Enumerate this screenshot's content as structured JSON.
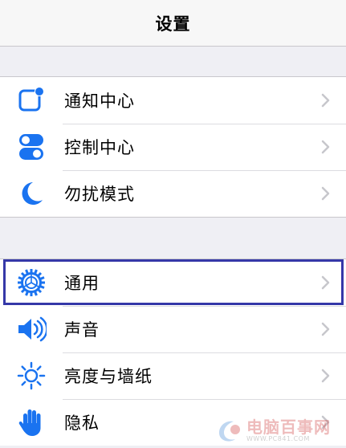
{
  "nav": {
    "title": "设置"
  },
  "groups": [
    {
      "items": [
        {
          "label": "通知中心",
          "icon": "notification-center-icon"
        },
        {
          "label": "控制中心",
          "icon": "control-center-icon"
        },
        {
          "label": "勿扰模式",
          "icon": "moon-icon"
        }
      ]
    },
    {
      "items": [
        {
          "label": "通用",
          "icon": "gear-icon"
        },
        {
          "label": "声音",
          "icon": "speaker-icon"
        },
        {
          "label": "亮度与墙纸",
          "icon": "sun-icon"
        },
        {
          "label": "隐私",
          "icon": "hand-icon"
        }
      ]
    }
  ],
  "highlighted_item": "通用",
  "watermark": {
    "name": "电脑百事网",
    "url": "WWW.PC841.COM"
  },
  "colors": {
    "accent": "#1a73f0",
    "highlight_border": "#3538a8",
    "background": "#efeff4"
  }
}
